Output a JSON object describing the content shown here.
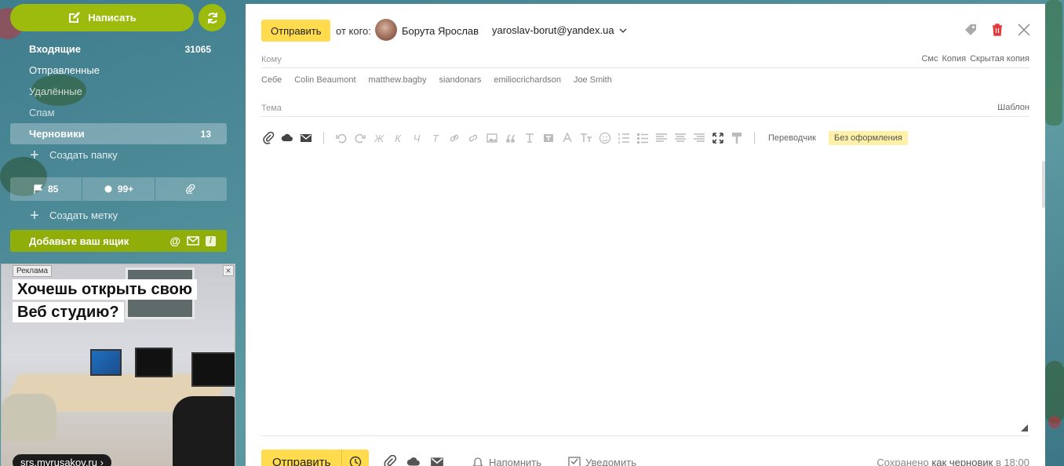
{
  "sidebar": {
    "compose_label": "Написать",
    "folders": [
      {
        "label": "Входящие",
        "count": "31065"
      },
      {
        "label": "Отправленные",
        "count": ""
      },
      {
        "label": "Удалённые",
        "count": ""
      },
      {
        "label": "Спам",
        "count": ""
      },
      {
        "label": "Черновики",
        "count": "13"
      }
    ],
    "create_folder": "Создать папку",
    "filters": {
      "flagged": "85",
      "unread": "99+"
    },
    "create_label": "Создать метку",
    "add_box": "Добавьте ваш ящик"
  },
  "ad": {
    "badge": "Реклама",
    "headline_1": "Хочешь открыть свою",
    "headline_2": "Веб студию?",
    "url": "srs.myrusakov.ru ›"
  },
  "compose": {
    "send_label": "Отправить",
    "from_label": "от кого:",
    "sender_name": "Борута Ярослав",
    "sender_email": "yaroslav-borut@yandex.ua",
    "to_label": "Кому",
    "to_options": [
      "Смс",
      "Копия",
      "Скрытая копия"
    ],
    "contacts": [
      "Себе",
      "Colin Beaumont",
      "matthew.bagby",
      "siandonars",
      "emiliocrichardson",
      "Joe Smith"
    ],
    "subject_label": "Тема",
    "template_label": "Шаблон",
    "toolbar": {
      "bold": "Ж",
      "italic": "К",
      "underline": "Ч",
      "strike": "Т",
      "translator": "Переводчик",
      "plain": "Без оформления"
    },
    "bottom": {
      "remind": "Напомнить",
      "notify": "Уведомить",
      "saved_prefix": "Сохранено",
      "saved_link": "как черновик",
      "saved_time": "в 18:00"
    }
  },
  "colors": {
    "accent_green": "#9cbb0d",
    "send_yellow": "#ffdb4d",
    "delete_red": "#e03c3c"
  }
}
